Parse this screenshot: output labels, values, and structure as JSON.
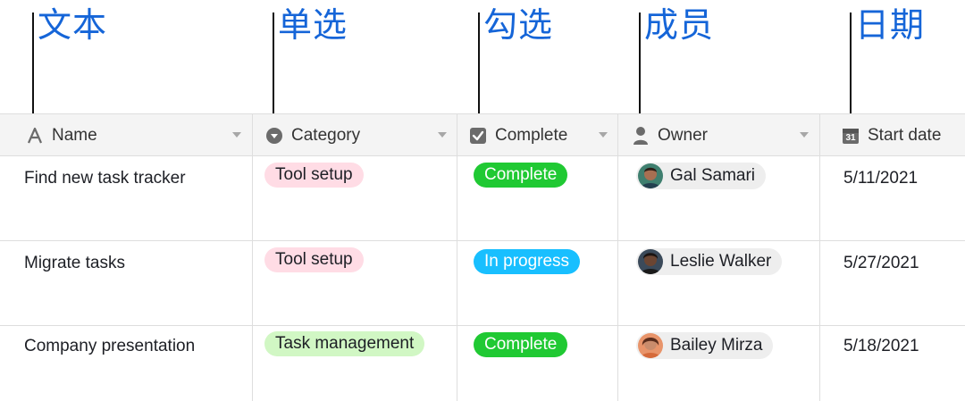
{
  "annotations": [
    {
      "key": "text",
      "label": "文本"
    },
    {
      "key": "single",
      "label": "单选"
    },
    {
      "key": "check",
      "label": "勾选"
    },
    {
      "key": "member",
      "label": "成员"
    },
    {
      "key": "date",
      "label": "日期"
    }
  ],
  "columns": {
    "name": {
      "label": "Name",
      "icon": "text-field-icon"
    },
    "category": {
      "label": "Category",
      "icon": "single-select-icon"
    },
    "complete": {
      "label": "Complete",
      "icon": "checkbox-icon"
    },
    "owner": {
      "label": "Owner",
      "icon": "person-icon"
    },
    "start_date": {
      "label": "Start date",
      "icon": "calendar-icon",
      "calendar_number": "31"
    }
  },
  "rows": [
    {
      "name": "Find new task tracker",
      "category": "Tool setup",
      "status": "Complete",
      "owner": "Gal Samari",
      "start_date": "5/11/2021"
    },
    {
      "name": "Migrate tasks",
      "category": "Tool setup",
      "status": "In progress",
      "owner": "Leslie Walker",
      "start_date": "5/27/2021"
    },
    {
      "name": "Company presentation",
      "category": "Task management",
      "status": "Complete",
      "owner": "Bailey Mirza",
      "start_date": "5/18/2021"
    }
  ],
  "colors": {
    "annotation": "#1565d8",
    "tool_setup": "#ffdce5",
    "task_management": "#d1f7c4",
    "complete": "#20c933",
    "in_progress": "#18bfff"
  }
}
